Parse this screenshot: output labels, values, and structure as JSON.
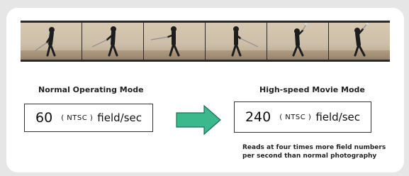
{
  "filmstrip": {
    "frames": [
      {
        "pose": "address"
      },
      {
        "pose": "takeaway"
      },
      {
        "pose": "backswing"
      },
      {
        "pose": "downswing"
      },
      {
        "pose": "impact"
      },
      {
        "pose": "follow-through"
      }
    ]
  },
  "normal": {
    "title": "Normal Operating Mode",
    "value": "60",
    "standard": "( NTSC )",
    "unit": "field/sec"
  },
  "highspeed": {
    "title": "High-speed Movie Mode",
    "value": "240",
    "standard": "( NTSC )",
    "unit": "field/sec",
    "note_line1": "Reads at four times more field numbers",
    "note_line2": "per second than normal photography"
  },
  "colors": {
    "arrow_fill": "#3bb88c",
    "arrow_stroke": "#1f6e54",
    "background": "#e6e6e6",
    "card": "#ffffff"
  }
}
